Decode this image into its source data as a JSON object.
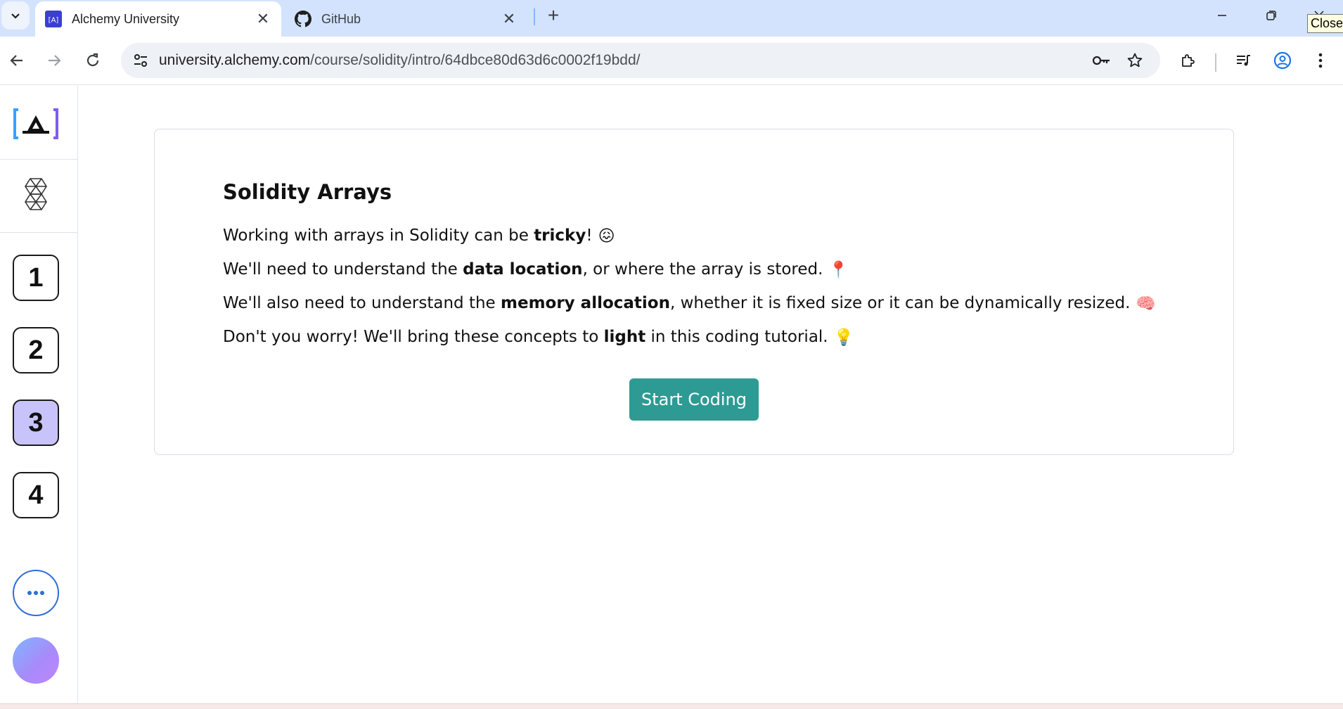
{
  "browser": {
    "tabs": [
      {
        "title": "Alchemy University",
        "favicon_text": "[A]",
        "active": true
      },
      {
        "title": "GitHub",
        "active": false
      }
    ],
    "url_host": "university.alchemy.com",
    "url_path": "/course/solidity/intro/64dbce80d63d6c0002f19bdd/",
    "close_tooltip": "Close"
  },
  "sidebar": {
    "steps": [
      {
        "label": "1",
        "active": false
      },
      {
        "label": "2",
        "active": false
      },
      {
        "label": "3",
        "active": true
      },
      {
        "label": "4",
        "active": false
      }
    ]
  },
  "lesson": {
    "title": "Solidity Arrays",
    "lines": [
      {
        "before": "Working with arrays in Solidity can be ",
        "bold": "tricky",
        "after": "!",
        "emoji": "😖"
      },
      {
        "before": "We'll need to understand the ",
        "bold": "data location",
        "after": ", or where the array is stored.",
        "emoji": "📍"
      },
      {
        "before": "We'll also need to understand the ",
        "bold": "memory allocation",
        "after": ", whether it is fixed size or it can be dynamically resized.",
        "emoji": "🧠"
      },
      {
        "before": "Don't you worry! We'll bring these concepts to ",
        "bold": "light",
        "after": " in this coding tutorial.",
        "emoji": "💡"
      }
    ],
    "start_button": "Start Coding"
  },
  "colors": {
    "accent": "#2e9a94",
    "active_step": "#c9c3fb",
    "tabstrip": "#d3e3fd"
  }
}
